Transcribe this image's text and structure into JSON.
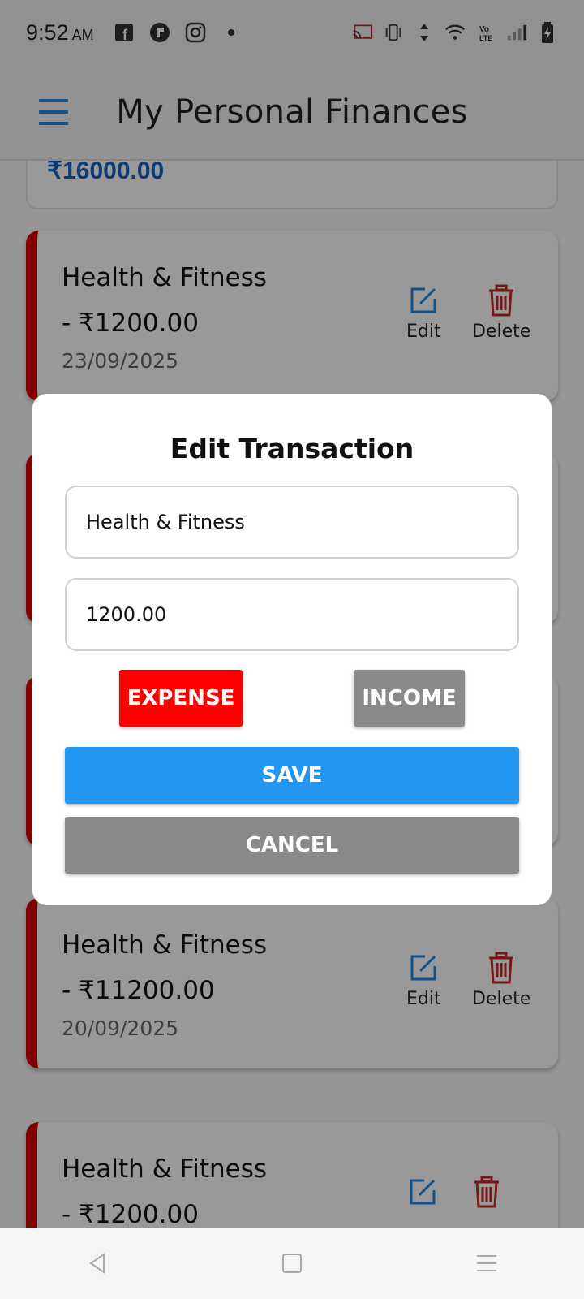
{
  "status_bar": {
    "time": "9:52",
    "ampm": "AM",
    "left_icons": [
      "facebook-icon",
      "social-app-icon",
      "instagram-icon",
      "dot-icon"
    ],
    "right_icons": [
      "cast-icon",
      "vibrate-icon",
      "data-arrows-icon",
      "wifi-icon",
      "volte-icon",
      "signal-icon",
      "battery-charging-icon"
    ]
  },
  "app_bar": {
    "title": "My Personal Finances",
    "menu_icon": "hamburger-menu-icon"
  },
  "summary": {
    "amount": "₹16000.00"
  },
  "transactions": [
    {
      "category": "Health & Fitness",
      "amount": "- ₹1200.00",
      "date": "23/09/2025",
      "edit_label": "Edit",
      "delete_label": "Delete"
    },
    {
      "category": "Health & Fitness",
      "amount": "- ₹11200.00",
      "date": "20/09/2025",
      "edit_label": "Edit",
      "delete_label": "Delete"
    },
    {
      "category": "Health & Fitness",
      "amount": "- ₹1200.00"
    }
  ],
  "dialog": {
    "title": "Edit Transaction",
    "name_value": "Health & Fitness",
    "amount_value": "1200.00",
    "expense_label": "EXPENSE",
    "income_label": "INCOME",
    "save_label": "SAVE",
    "cancel_label": "CANCEL",
    "selected_type": "expense"
  },
  "colors": {
    "accent_blue": "#2196f3",
    "expense_red": "#ff0000",
    "card_border_red": "#d50000",
    "neutral_button": "#8a8a8a",
    "summary_blue": "#1565c0"
  },
  "nav_bar": {
    "icons": [
      "back-icon",
      "home-icon",
      "recents-icon"
    ]
  }
}
